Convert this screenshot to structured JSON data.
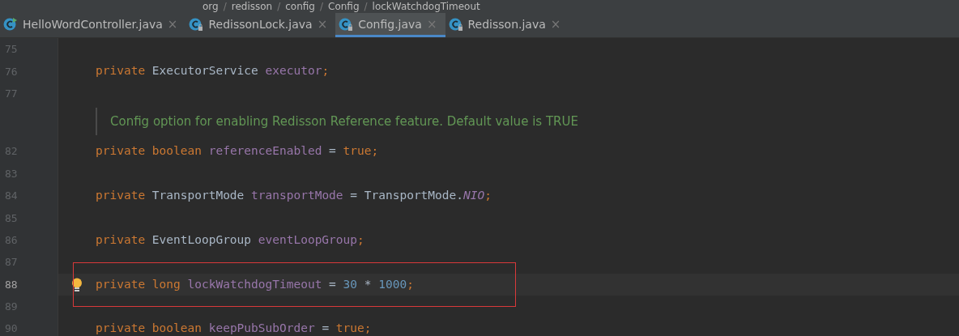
{
  "breadcrumb": {
    "separator": "/",
    "items": [
      "org",
      "redisson",
      "config",
      "Config",
      "lockWatchdogTimeout"
    ]
  },
  "tabs": [
    {
      "label": "HelloWordController.java",
      "selected": false,
      "kind": "runnable",
      "close": "×"
    },
    {
      "label": "RedissonLock.java",
      "selected": false,
      "kind": "locked",
      "close": "×"
    },
    {
      "label": "Config.java",
      "selected": true,
      "kind": "locked",
      "close": "×"
    },
    {
      "label": "Redisson.java",
      "selected": false,
      "kind": "locked",
      "close": "×"
    }
  ],
  "lines": [
    {
      "kind": "blank",
      "number": "75",
      "current": false,
      "highlighted": false,
      "bulb": false
    },
    {
      "kind": "code",
      "number": "76",
      "current": false,
      "highlighted": false,
      "bulb": false,
      "words": [
        [
          {
            "kind": "keyword",
            "text": "private"
          }
        ],
        [
          {
            "kind": "type",
            "text": "ExecutorService"
          }
        ],
        [
          {
            "kind": "field",
            "text": "executor"
          },
          {
            "kind": "keyword",
            "text": ";"
          }
        ]
      ]
    },
    {
      "kind": "blank",
      "number": "77",
      "current": false,
      "highlighted": false,
      "bulb": false
    },
    {
      "kind": "doc",
      "text": "Config option for enabling Redisson Reference feature. Default value is TRUE"
    },
    {
      "kind": "code",
      "number": "82",
      "current": false,
      "highlighted": false,
      "bulb": false,
      "words": [
        [
          {
            "kind": "keyword",
            "text": "private"
          }
        ],
        [
          {
            "kind": "keyword",
            "text": "boolean"
          }
        ],
        [
          {
            "kind": "field",
            "text": "referenceEnabled"
          }
        ],
        [
          {
            "kind": "type",
            "text": "="
          }
        ],
        [
          {
            "kind": "keyword",
            "text": "true;"
          }
        ]
      ]
    },
    {
      "kind": "blank",
      "number": "83",
      "current": false,
      "highlighted": false,
      "bulb": false
    },
    {
      "kind": "code",
      "number": "84",
      "current": false,
      "highlighted": false,
      "bulb": false,
      "words": [
        [
          {
            "kind": "keyword",
            "text": "private"
          }
        ],
        [
          {
            "kind": "type",
            "text": "TransportMode"
          }
        ],
        [
          {
            "kind": "field",
            "text": "transportMode"
          }
        ],
        [
          {
            "kind": "type",
            "text": "="
          }
        ],
        [
          {
            "kind": "type",
            "text": "TransportMode."
          },
          {
            "kind": "constant",
            "text": "NIO"
          },
          {
            "kind": "keyword",
            "text": ";"
          }
        ]
      ]
    },
    {
      "kind": "blank",
      "number": "85",
      "current": false,
      "highlighted": false,
      "bulb": false
    },
    {
      "kind": "code",
      "number": "86",
      "current": false,
      "highlighted": false,
      "bulb": false,
      "words": [
        [
          {
            "kind": "keyword",
            "text": "private"
          }
        ],
        [
          {
            "kind": "type",
            "text": "EventLoopGroup"
          }
        ],
        [
          {
            "kind": "field",
            "text": "eventLoopGroup"
          },
          {
            "kind": "keyword",
            "text": ";"
          }
        ]
      ]
    },
    {
      "kind": "blank",
      "number": "87",
      "current": false,
      "highlighted": false,
      "bulb": false
    },
    {
      "kind": "code",
      "number": "88",
      "current": true,
      "highlighted": true,
      "bulb": true,
      "words": [
        [
          {
            "kind": "keyword",
            "text": "private"
          }
        ],
        [
          {
            "kind": "keyword",
            "text": "long"
          }
        ],
        [
          {
            "kind": "field",
            "text": "lockWatchdogTimeout"
          }
        ],
        [
          {
            "kind": "type",
            "text": "="
          }
        ],
        [
          {
            "kind": "number",
            "text": "30"
          }
        ],
        [
          {
            "kind": "type",
            "text": "*"
          }
        ],
        [
          {
            "kind": "number",
            "text": "1000"
          },
          {
            "kind": "keyword",
            "text": ";"
          }
        ]
      ]
    },
    {
      "kind": "blank",
      "number": "89",
      "current": false,
      "highlighted": false,
      "bulb": false
    },
    {
      "kind": "code",
      "number": "90",
      "current": false,
      "highlighted": false,
      "bulb": false,
      "words": [
        [
          {
            "kind": "keyword",
            "text": "private"
          }
        ],
        [
          {
            "kind": "keyword",
            "text": "boolean"
          }
        ],
        [
          {
            "kind": "field",
            "text": "keepPubSubOrder"
          }
        ],
        [
          {
            "kind": "type",
            "text": "="
          }
        ],
        [
          {
            "kind": "keyword",
            "text": "true;"
          }
        ]
      ]
    }
  ]
}
